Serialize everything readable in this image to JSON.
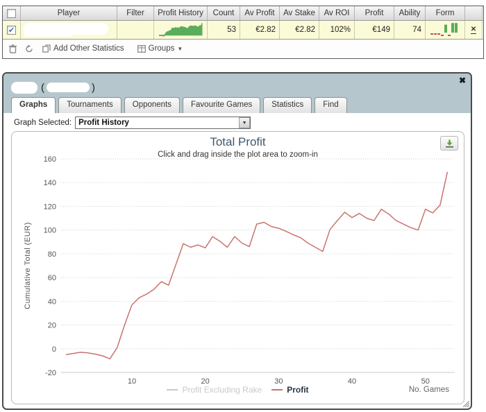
{
  "icons": {
    "close": "✖",
    "remove": "✕",
    "check": "✔",
    "dropdown": "▼"
  },
  "colors": {
    "dialog_header_bg": "#b5c7cc",
    "row_highlight": "#fbfbd7",
    "profit_line": "#c9736c",
    "sparkline_green": "#5aad5a",
    "sparkline_red": "#c0554d",
    "disabled_legend": "#c9c9c9",
    "chart_title": "#3e576f"
  },
  "table": {
    "columns": [
      "",
      "Player",
      "Filter",
      "Profit History",
      "Count",
      "Av Profit",
      "Av Stake",
      "Av ROI",
      "Profit",
      "Ability",
      "Form",
      ""
    ],
    "row": {
      "checked": true,
      "count": "53",
      "av_profit": "€2.82",
      "av_stake": "€2.82",
      "av_roi": "102%",
      "profit": "€149",
      "ability": "74",
      "form": [
        -1,
        -1,
        -1,
        -3,
        10,
        -3,
        12,
        12
      ]
    },
    "toolbar": {
      "add_other_statistics": "Add Other Statistics",
      "groups": "Groups"
    }
  },
  "dialog": {
    "title_open_paren": "(",
    "title_close_paren": ")",
    "tabs": [
      {
        "label": "Graphs",
        "active": true
      },
      {
        "label": "Tournaments",
        "active": false
      },
      {
        "label": "Opponents",
        "active": false
      },
      {
        "label": "Favourite Games",
        "active": false
      },
      {
        "label": "Statistics",
        "active": false
      },
      {
        "label": "Find",
        "active": false
      }
    ],
    "graph_selected_label": "Graph Selected:",
    "graph_selected_value": "Profit History"
  },
  "chart_data": {
    "type": "line",
    "title": "Total Profit",
    "subtitle": "Click and drag inside the plot area to zoom-in",
    "xlabel": "No. Games",
    "ylabel": "Cumulative Total (EUR)",
    "xlim": [
      0.35,
      54
    ],
    "ylim": [
      -20,
      160
    ],
    "ytick_step": 20,
    "xticks": [
      10,
      20,
      30,
      40,
      50
    ],
    "grid": "dotted",
    "legend_position": "bottom",
    "series": [
      {
        "name": "Profit Excluding Rake",
        "color": "#c9c9c9",
        "visible": false,
        "values": []
      },
      {
        "name": "Profit",
        "color": "#c9736c",
        "visible": true,
        "x_start": 1,
        "values": [
          -5,
          -4,
          -3,
          -3.5,
          -4.5,
          -6,
          -8.5,
          1,
          20,
          37,
          43,
          46,
          50,
          56.5,
          53.5,
          71,
          88.5,
          85.5,
          87.5,
          85,
          94.5,
          90.5,
          85.5,
          94.5,
          89,
          86,
          105,
          106.5,
          103,
          101.5,
          99,
          96,
          93.5,
          89,
          85.5,
          82,
          100.5,
          108,
          115,
          110.5,
          114,
          110,
          108,
          117.5,
          113.5,
          108,
          105,
          102,
          100,
          117.5,
          114.5,
          121,
          149
        ]
      }
    ]
  }
}
